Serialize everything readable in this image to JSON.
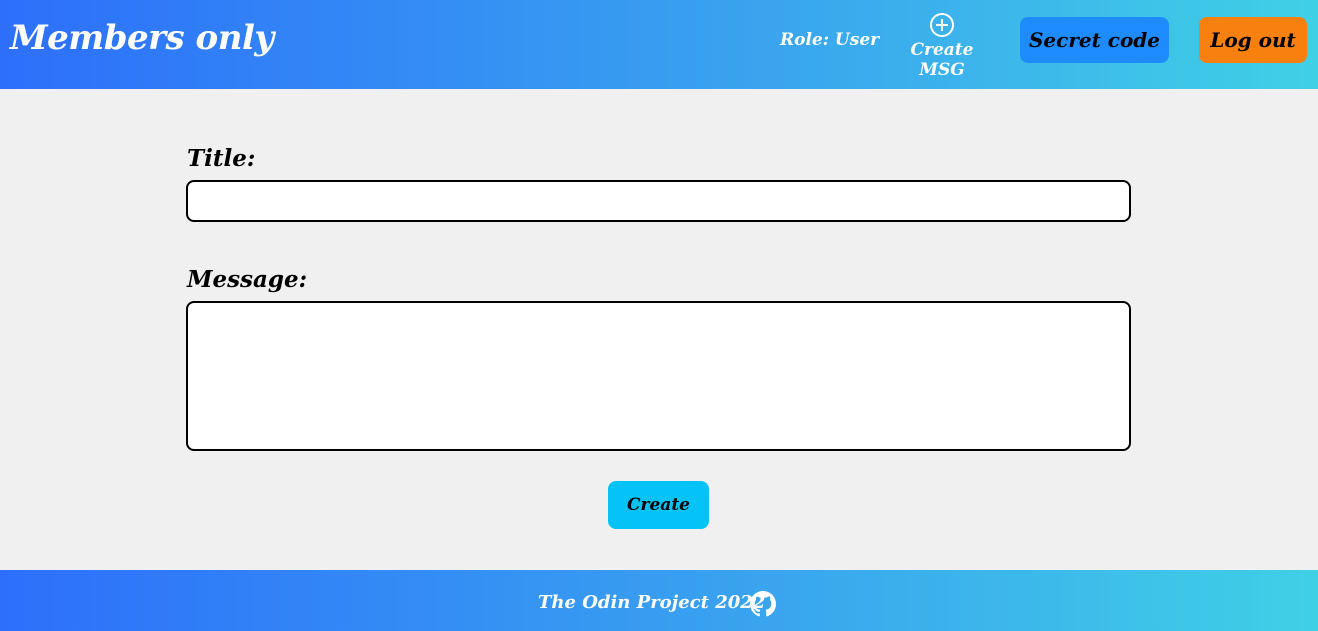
{
  "header": {
    "brand": "Members only",
    "role": "Role: User",
    "create_msg_label": "Create MSG",
    "create_msg_icon": "plus-circle-icon",
    "secret_code_label": "Secret code",
    "logout_label": "Log out"
  },
  "form": {
    "title_label": "Title:",
    "title_value": "",
    "message_label": "Message:",
    "message_value": "",
    "create_label": "Create"
  },
  "footer": {
    "text": "The Odin Project 2022",
    "icon": "github-icon"
  },
  "colors": {
    "gradient_start": "#2d6ffb",
    "gradient_end": "#3fd0e6",
    "secret_button": "#1e8cff",
    "logout_button": "#f7800f",
    "create_button": "#05c3f7",
    "background": "#f0f0f0"
  }
}
